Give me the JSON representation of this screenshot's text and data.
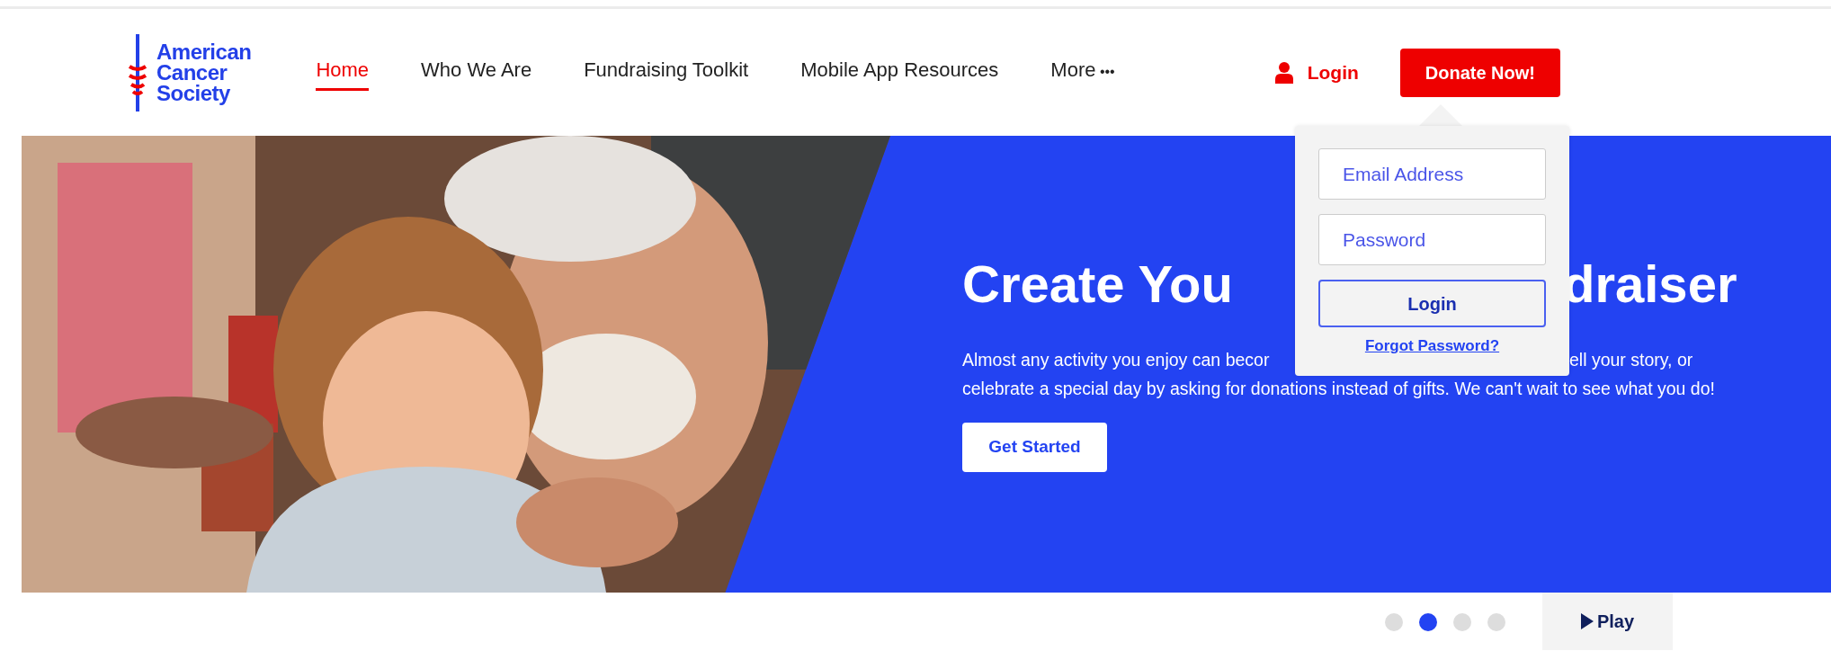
{
  "logo": {
    "lines": [
      "American",
      "Cancer",
      "Society"
    ]
  },
  "nav": [
    {
      "label": "Home",
      "selected": true
    },
    {
      "label": "Who We Are",
      "selected": false
    },
    {
      "label": "Fundraising Toolkit",
      "selected": false
    },
    {
      "label": "Mobile App Resources",
      "selected": false
    },
    {
      "label": "More",
      "selected": false,
      "more": "•••"
    }
  ],
  "login_link": "Login",
  "donate_button": "Donate Now!",
  "login_dropdown": {
    "email": {
      "placeholder": "Email Address"
    },
    "password": {
      "placeholder": "Password"
    },
    "button": "Login",
    "forgot": "Forgot Password?"
  },
  "hero": {
    "kind": "picture",
    "heading_parts": [
      "Create You",
      "draiser"
    ],
    "text_line_1_parts": [
      "Almost any activity you enjoy can becor",
      "ell your story, or"
    ],
    "text_line_2": "celebrate a special day by asking for donations instead of gifts. We can't wait to see what you do!",
    "button": "Get Started"
  },
  "carousel": {
    "dots": [
      {
        "selected": false
      },
      {
        "selected": true
      },
      {
        "selected": false
      },
      {
        "selected": false
      }
    ],
    "play_button": "Play"
  }
}
